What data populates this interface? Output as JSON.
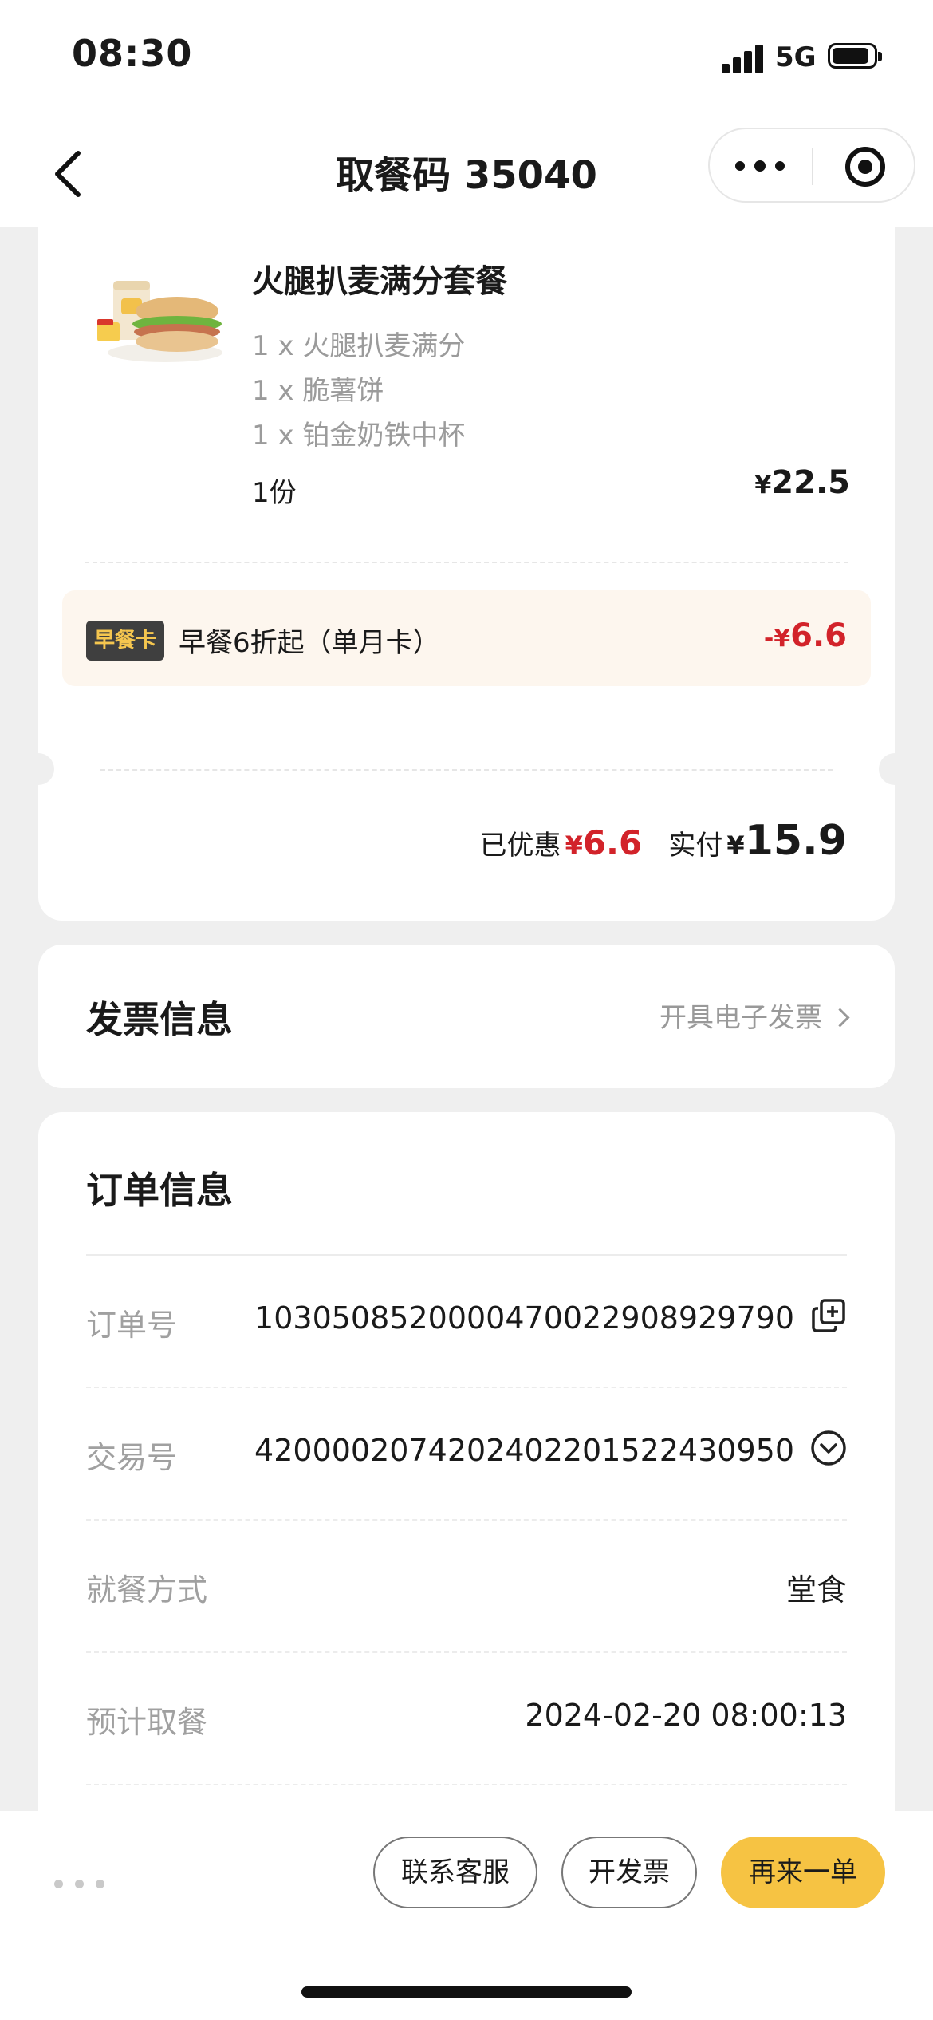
{
  "status_bar": {
    "time": "08:30",
    "network": "5G"
  },
  "nav": {
    "title": "取餐码 35040"
  },
  "order": {
    "meal_name": "火腿扒麦满分套餐",
    "items": [
      "1 x 火腿扒麦满分",
      "1 x 脆薯饼",
      "1 x 铂金奶铁中杯"
    ],
    "quantity": "1份",
    "price_symbol": "¥",
    "price": "22.5",
    "promo": {
      "tag": "早餐卡",
      "text": "早餐6折起（单月卡）",
      "amount_prefix": "-¥",
      "amount": "6.6"
    },
    "totals": {
      "discount_label": "已优惠",
      "discount_symbol": "¥",
      "discount_amount": "6.6",
      "paid_label": "实付",
      "paid_symbol": "¥",
      "paid_amount": "15.9"
    }
  },
  "invoice": {
    "title": "发票信息",
    "link": "开具电子发票"
  },
  "order_info": {
    "title": "订单信息",
    "rows": [
      {
        "label": "订单号",
        "value": "1030508520000470022908929790"
      },
      {
        "label": "交易号",
        "value": "4200002074202402201522430950"
      },
      {
        "label": "就餐方式",
        "value": "堂食"
      },
      {
        "label": "预计取餐",
        "value": "2024-02-20 08:00:13"
      }
    ]
  },
  "bottom_bar": {
    "contact": "联系客服",
    "invoice": "开发票",
    "reorder": "再来一单"
  },
  "icons": {
    "back": "chevron-left-icon",
    "more": "more-dots-icon",
    "close": "target-circle-icon",
    "copy": "copy-icon",
    "expand": "chevron-down-circle-icon"
  },
  "colors": {
    "accent": "#f6c343",
    "discount": "#d2232a",
    "promo_bg": "#fdf6ee"
  }
}
